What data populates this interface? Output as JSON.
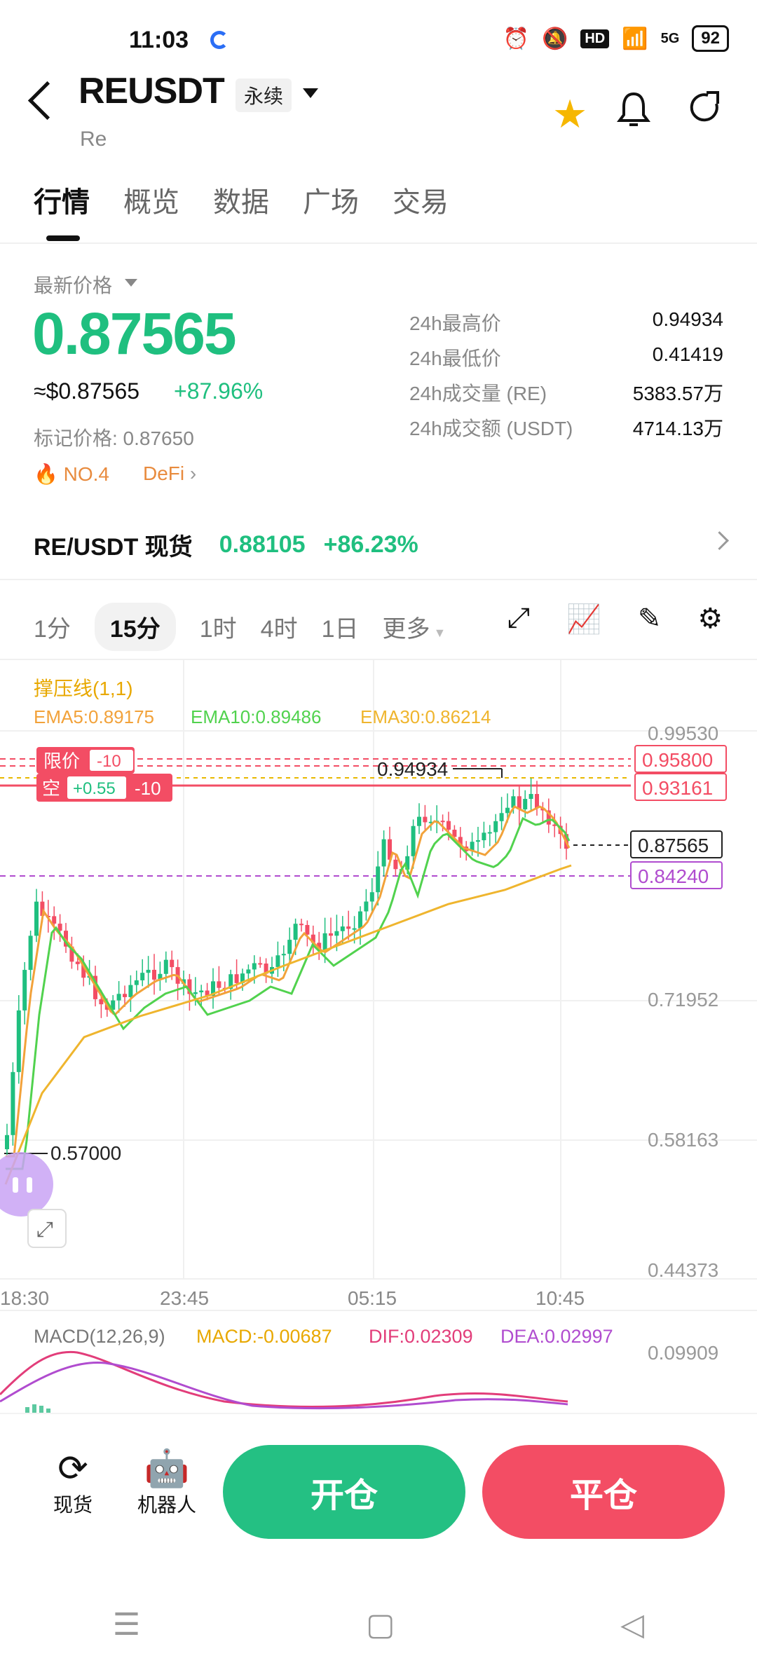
{
  "status": {
    "time": "11:03",
    "battery": "92",
    "network": "5G",
    "hd": "HD"
  },
  "header": {
    "symbol": "REUSDT",
    "badge": "永续",
    "subtitle": "Re"
  },
  "tabs": [
    "行情",
    "概览",
    "数据",
    "广场",
    "交易"
  ],
  "price": {
    "label": "最新价格",
    "last": "0.87565",
    "usd": "≈$0.87565",
    "change": "+87.96%",
    "mark": "标记价格: 0.87650",
    "rank": "NO.4",
    "category": "DeFi"
  },
  "stats": [
    {
      "k": "24h最高价",
      "v": "0.94934"
    },
    {
      "k": "24h最低价",
      "v": "0.41419"
    },
    {
      "k": "24h成交量 (RE)",
      "v": "5383.57万"
    },
    {
      "k": "24h成交额 (USDT)",
      "v": "4714.13万"
    }
  ],
  "spot": {
    "name": "RE/USDT 现货",
    "price": "0.88105",
    "change": "+86.23%"
  },
  "intervals": [
    "1分",
    "15分",
    "1时",
    "4时",
    "1日",
    "更多"
  ],
  "intervalSelected": "15分",
  "indicator": {
    "sr": "撑压线(1,1)",
    "ema5": "EMA5:0.89175",
    "ema10": "EMA10:0.89486",
    "ema30": "EMA30:0.86214"
  },
  "orders": {
    "limit_label": "限价",
    "limit_qty": "-10",
    "short_label": "空",
    "short_pnl": "+0.55",
    "short_qty": "-10"
  },
  "priceLevels": {
    "p1": "0.99530",
    "p2": "0.95800",
    "p3": "0.93161",
    "current": "0.87565",
    "p4": "0.84240",
    "p5": "0.71952",
    "p6": "0.58163",
    "p7": "0.44373",
    "high_mark": "0.94934",
    "low_mark": "0.57000"
  },
  "timeAxis": [
    "18:30",
    "23:45",
    "05:15",
    "10:45"
  ],
  "macd": {
    "title": "MACD(12,26,9)",
    "macd": "MACD:-0.00687",
    "dif": "DIF:0.02309",
    "dea": "DEA:0.02997",
    "axis": "0.09909"
  },
  "bottom": {
    "spot": "现货",
    "robot": "机器人",
    "open": "开仓",
    "close": "平仓"
  },
  "colors": {
    "up": "#1fbf7f",
    "down": "#f34d64",
    "ema5": "#f2a23a",
    "ema10": "#51d24e",
    "ema30": "#efb52e"
  }
}
